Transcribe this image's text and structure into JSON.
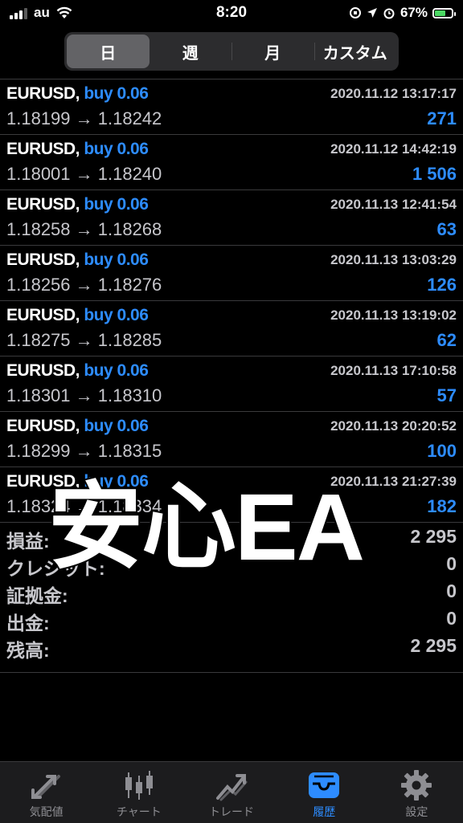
{
  "status_bar": {
    "carrier": "au",
    "time": "8:20",
    "battery": "67%",
    "battery_level": 0.67
  },
  "period_tabs": [
    {
      "label": "日",
      "active": true
    },
    {
      "label": "週",
      "active": false
    },
    {
      "label": "月",
      "active": false
    },
    {
      "label": "カスタム",
      "active": false
    }
  ],
  "trades": [
    {
      "symbol": "EURUSD,",
      "side": "buy 0.06",
      "time": "2020.11.12 13:17:17",
      "prices": "1.18199 → 1.18242",
      "profit": "271"
    },
    {
      "symbol": "EURUSD,",
      "side": "buy 0.06",
      "time": "2020.11.12 14:42:19",
      "prices": "1.18001 → 1.18240",
      "profit": "1 506"
    },
    {
      "symbol": "EURUSD,",
      "side": "buy 0.06",
      "time": "2020.11.13 12:41:54",
      "prices": "1.18258 → 1.18268",
      "profit": "63"
    },
    {
      "symbol": "EURUSD,",
      "side": "buy 0.06",
      "time": "2020.11.13 13:03:29",
      "prices": "1.18256 → 1.18276",
      "profit": "126"
    },
    {
      "symbol": "EURUSD,",
      "side": "buy 0.06",
      "time": "2020.11.13 13:19:02",
      "prices": "1.18275 → 1.18285",
      "profit": "62"
    },
    {
      "symbol": "EURUSD,",
      "side": "buy 0.06",
      "time": "2020.11.13 17:10:58",
      "prices": "1.18301 → 1.18310",
      "profit": "57"
    },
    {
      "symbol": "EURUSD,",
      "side": "buy 0.06",
      "time": "2020.11.13 20:20:52",
      "prices": "1.18299 → 1.18315",
      "profit": "100"
    },
    {
      "symbol": "EURUSD,",
      "side": "buy 0.06",
      "time": "2020.11.13 21:27:39",
      "prices": "1.18324 → 1.18334",
      "profit": "182"
    }
  ],
  "summary": [
    {
      "label": "損益:",
      "value": "2 295"
    },
    {
      "label": "クレジット:",
      "value": "0"
    },
    {
      "label": "証拠金:",
      "value": "0"
    },
    {
      "label": "出金:",
      "value": "0"
    },
    {
      "label": "残高:",
      "value": "2 295"
    }
  ],
  "watermark": "安心EA",
  "tab_bar": [
    {
      "label": "気配値",
      "icon": "quotes-arrows-icon",
      "active": false
    },
    {
      "label": "チャート",
      "icon": "candlestick-chart-icon",
      "active": false
    },
    {
      "label": "トレード",
      "icon": "trade-trend-icon",
      "active": false
    },
    {
      "label": "履歴",
      "icon": "history-inbox-icon",
      "active": true
    },
    {
      "label": "設定",
      "icon": "settings-gear-icon",
      "active": false
    }
  ],
  "colors": {
    "accent": "#2d8cff",
    "background": "#000000",
    "battery": "#4cd964"
  }
}
